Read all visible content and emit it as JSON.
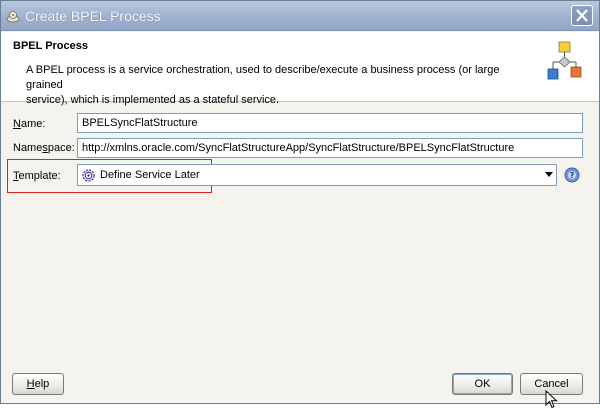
{
  "window": {
    "title": "Create BPEL Process"
  },
  "header": {
    "title": "BPEL Process",
    "description_line1": "A BPEL process is a service orchestration, used to describe/execute a business process (or large grained",
    "description_line2": "service), which is implemented as a stateful service."
  },
  "form": {
    "name": {
      "label_mnemonic": "N",
      "label_rest": "ame:",
      "value": "BPELSyncFlatStructure"
    },
    "namespace": {
      "label_pre": "Name",
      "label_mnemonic": "s",
      "label_rest": "pace:",
      "value": "http://xmlns.oracle.com/SyncFlatStructureApp/SyncFlatStructure/BPELSyncFlatStructure"
    },
    "template": {
      "label_mnemonic": "T",
      "label_rest": "emplate:",
      "selected": "Define Service Later"
    }
  },
  "buttons": {
    "help_mnemonic": "H",
    "help_rest": "elp",
    "ok": "OK",
    "cancel": "Cancel"
  },
  "colors": {
    "highlight_border": "#e02020",
    "titlebar": "#a1b3d0"
  },
  "icons": {
    "title": "bpel-gear-icon",
    "header": "bpel-process-diagram-icon",
    "template": "gear-icon",
    "help": "help-icon",
    "close": "close-icon"
  }
}
